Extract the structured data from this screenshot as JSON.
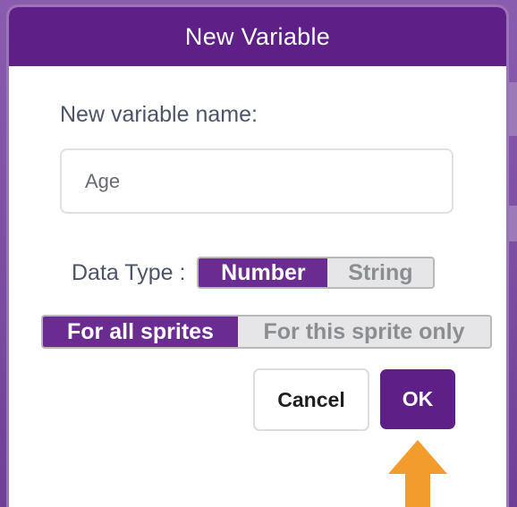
{
  "dialog": {
    "title": "New Variable",
    "name_label": "New variable name:",
    "name_value": "Age"
  },
  "data_type": {
    "label": "Data Type :",
    "options": [
      "Number",
      "String"
    ],
    "selected": "Number"
  },
  "scope": {
    "options": [
      "For all sprites",
      "For this sprite only"
    ],
    "selected": "For all sprites"
  },
  "buttons": {
    "cancel": "Cancel",
    "ok": "OK"
  },
  "colors": {
    "accent": "#5e1f86",
    "active_segment": "#6a2c91",
    "inactive_segment": "#e6e6e8",
    "pointer_arrow": "#f39c2e"
  },
  "annotation": {
    "pointer_icon": "up-arrow-icon"
  }
}
